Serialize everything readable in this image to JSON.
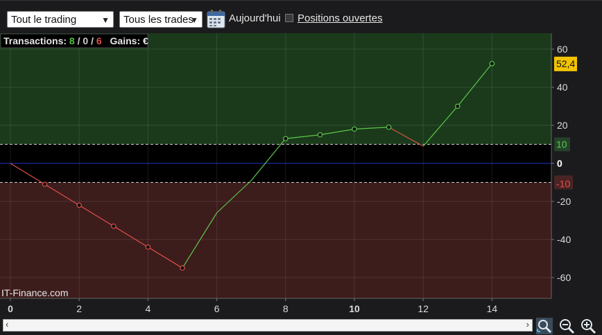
{
  "toolbar": {
    "filter_select": "Tout le trading",
    "trades_select": "Tous les trades",
    "today_label": "Aujourd'hui",
    "open_positions_label": "Positions ouvertes",
    "open_positions_checked": false
  },
  "stats": {
    "transactions_label": "Transactions:",
    "wins": "8",
    "sep1": "/",
    "neutral": "0",
    "sep2": "/",
    "losses": "6",
    "gains_label": "Gains:",
    "currency": "€"
  },
  "watermark": "IT-Finance.com",
  "colors": {
    "win_zone": "#1b3a1b",
    "loss_zone": "#3d1c1c",
    "neutral_zone": "#000000",
    "up_line": "#5cc84a",
    "down_line": "#e2504a",
    "zero_line": "#2233cc",
    "last_value_badge": "#f2c300"
  },
  "chart_data": {
    "type": "line",
    "x": [
      0,
      1,
      2,
      3,
      4,
      5,
      6,
      7,
      8,
      9,
      10,
      11,
      12,
      13,
      14
    ],
    "y": [
      0,
      -11,
      -22,
      -33,
      -44,
      -55,
      -26,
      -9,
      13,
      15,
      18,
      19,
      9,
      30,
      52.4
    ],
    "markers": [
      false,
      true,
      true,
      true,
      true,
      true,
      false,
      false,
      true,
      true,
      true,
      true,
      false,
      true,
      true
    ],
    "xlim": [
      0,
      15.6
    ],
    "ylim": [
      -71,
      69
    ],
    "x_ticks": [
      "0",
      "2",
      "4",
      "6",
      "8",
      "10",
      "12",
      "14"
    ],
    "y_ticks": [
      "60",
      "40",
      "20",
      "0",
      "-20",
      "-40",
      "-60"
    ],
    "thresholds": {
      "upper": 10,
      "lower": -10
    },
    "upper_label": "10",
    "lower_label": "-10",
    "zero_label": "0",
    "last_value": "52,4",
    "grid": true
  }
}
